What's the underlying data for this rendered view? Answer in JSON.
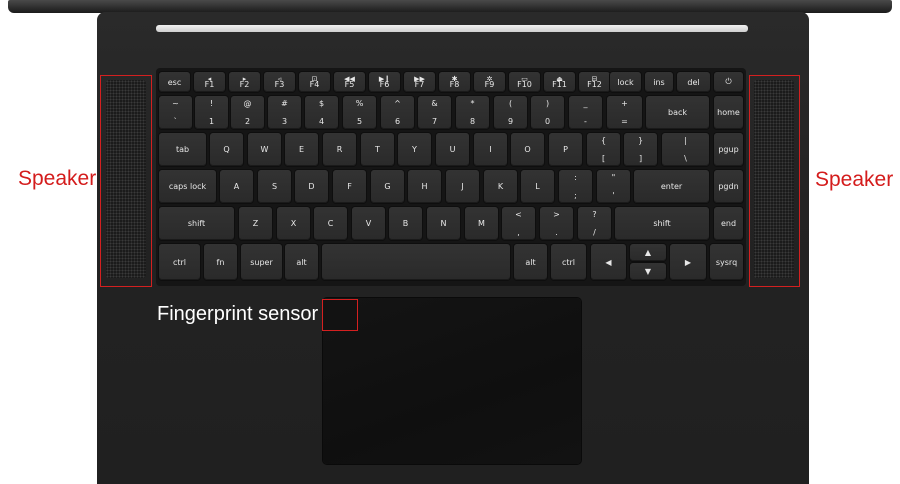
{
  "callouts": {
    "speaker_left": "Speaker",
    "speaker_right": "Speaker",
    "fingerprint": "Fingerprint sensor"
  },
  "colors": {
    "callout": "#d41c1c",
    "deck": "#232323",
    "key": "#2f2f2f",
    "key_text": "#e8e8e8"
  },
  "keys": {
    "esc": "esc",
    "f1_icon": "◂",
    "f1": "F1",
    "f2_icon": "▸",
    "f2": "F2",
    "f3_icon": "◃",
    "f3": "F3",
    "f4_icon": "⊡",
    "f4": "F4",
    "f5_icon": "◀◀",
    "f5": "F5",
    "f6_icon": "▶❙",
    "f6": "F6",
    "f7_icon": "▶▶",
    "f7": "F7",
    "f8_icon": "✱",
    "f8": "F8",
    "f9_icon": "✲",
    "f9": "F9",
    "f10_icon": "▭",
    "f10": "F10",
    "f11_icon": "⏏",
    "f11": "F11",
    "f12_icon": "⊟",
    "f12": "F12",
    "lock": "lock",
    "ins": "ins",
    "del": "del",
    "power": "⏻",
    "tilde_t": "~",
    "tilde_b": "`",
    "n1_t": "!",
    "n1_b": "1",
    "n2_t": "@",
    "n2_b": "2",
    "n3_t": "#",
    "n3_b": "3",
    "n4_t": "$",
    "n4_b": "4",
    "n5_t": "%",
    "n5_b": "5",
    "n6_t": "^",
    "n6_b": "6",
    "n7_t": "&",
    "n7_b": "7",
    "n8_t": "*",
    "n8_b": "8",
    "n9_t": "(",
    "n9_b": "9",
    "n0_t": ")",
    "n0_b": "0",
    "minus_t": "_",
    "minus_b": "-",
    "plus_t": "+",
    "plus_b": "=",
    "back": "back",
    "home": "home",
    "tab": "tab",
    "q": "Q",
    "w": "W",
    "e": "E",
    "r": "R",
    "t": "T",
    "y": "Y",
    "u": "U",
    "i": "I",
    "o": "O",
    "p": "P",
    "lbrace_t": "{",
    "lbrace_b": "[",
    "rbrace_t": "}",
    "rbrace_b": "]",
    "pipe_t": "|",
    "pipe_b": "\\",
    "pgup": "pgup",
    "caps": "caps lock",
    "a": "A",
    "s": "S",
    "d": "D",
    "f": "F",
    "g": "G",
    "h": "H",
    "j": "J",
    "k": "K",
    "l": "L",
    "colon_t": ":",
    "colon_b": ";",
    "quote_t": "\"",
    "quote_b": "'",
    "enter": "enter",
    "pgdn": "pgdn",
    "shift_l": "shift",
    "z": "Z",
    "x": "X",
    "c": "C",
    "v": "V",
    "b": "B",
    "n": "N",
    "m": "M",
    "lt_t": "<",
    "lt_b": ",",
    "gt_t": ">",
    "gt_b": ".",
    "qm_t": "?",
    "qm_b": "/",
    "shift_r": "shift",
    "end": "end",
    "ctrl_l": "ctrl",
    "fn": "fn",
    "super": "super",
    "alt_l": "alt",
    "alt_r": "alt",
    "ctrl_r": "ctrl",
    "left": "◀",
    "up": "▲",
    "down": "▼",
    "right": "▶",
    "sysrq": "sysrq"
  }
}
